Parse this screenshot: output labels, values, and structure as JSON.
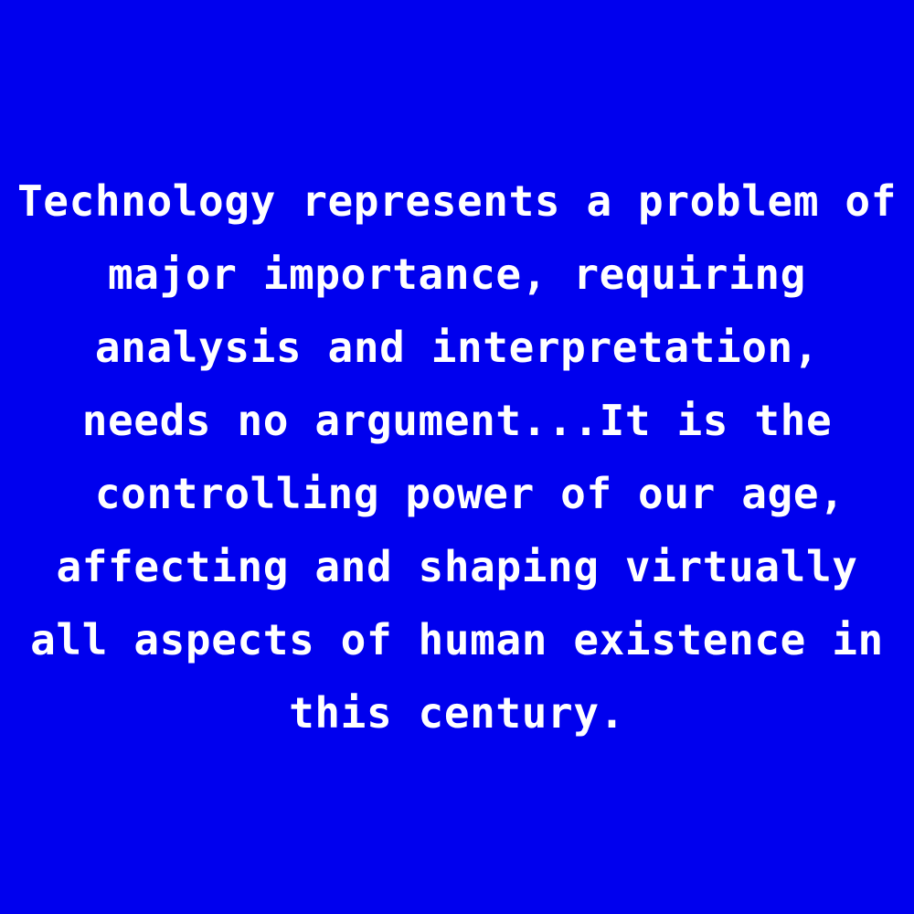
{
  "colors": {
    "background": "#0000ee",
    "text": "#ffffff"
  },
  "quote": {
    "lines": [
      "Technology represents a problem of",
      "major importance, requiring",
      "analysis and interpretation,",
      "needs no argument...It is the",
      " controlling power of our age,",
      "affecting and shaping virtually",
      "all aspects of human existence in",
      "this century."
    ]
  }
}
